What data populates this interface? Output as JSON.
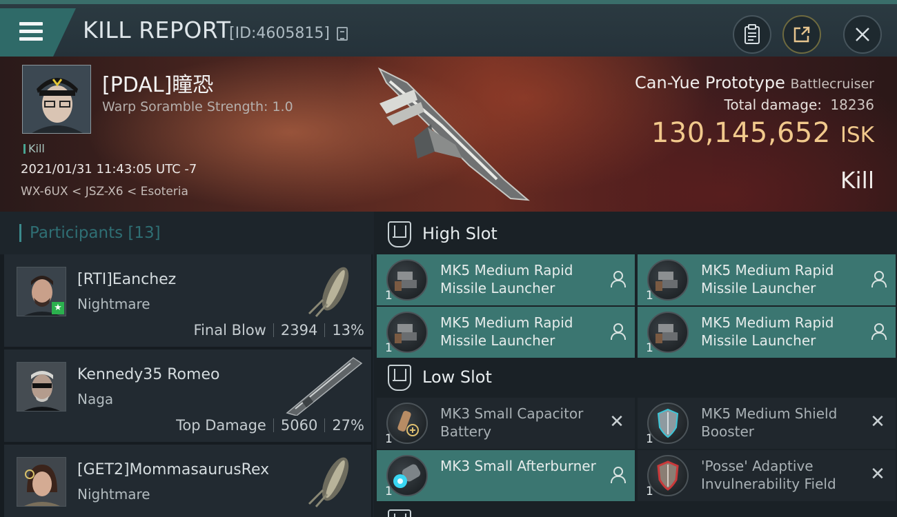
{
  "header": {
    "title": "KILL REPORT",
    "id_text": "[ID:4605815]"
  },
  "victim": {
    "name": "[PDAL]瞳恐",
    "subtitle": "Warp Soramble Strength: 1.0",
    "tag": "Kill",
    "timestamp": "2021/01/31 11:43:05 UTC -7",
    "location": "WX-6UX < JSZ-X6 < Esoteria",
    "ship_name": "Can-Yue Prototype",
    "ship_class": "Battlecruiser",
    "total_damage_label": "Total damage:",
    "total_damage": "18236",
    "isk_value": "130,145,652",
    "isk_unit": "ISK",
    "result": "Kill"
  },
  "participants": {
    "label": "Participants",
    "count": "[13]",
    "rows": [
      {
        "name": "[RTI]Eanchez",
        "ship": "Nightmare",
        "role": "Final Blow",
        "damage": "2394",
        "percent": "13%"
      },
      {
        "name": "Kennedy35 Romeo",
        "ship": "Naga",
        "role": "Top Damage",
        "damage": "5060",
        "percent": "27%"
      },
      {
        "name": "[GET2]MommasaurusRex",
        "ship": "Nightmare",
        "role": "",
        "damage": "",
        "percent": ""
      }
    ]
  },
  "slots": {
    "high": {
      "label": "High Slot",
      "modules": [
        {
          "name": "MK5 Medium Rapid Missile Launcher",
          "qty": "1",
          "state": "fitted"
        },
        {
          "name": "MK5 Medium Rapid Missile Launcher",
          "qty": "1",
          "state": "fitted"
        },
        {
          "name": "MK5 Medium Rapid Missile Launcher",
          "qty": "1",
          "state": "fitted"
        },
        {
          "name": "MK5 Medium Rapid Missile Launcher",
          "qty": "1",
          "state": "fitted"
        }
      ]
    },
    "low": {
      "label": "Low Slot",
      "modules": [
        {
          "name": "MK3 Small Capacitor Battery",
          "qty": "1",
          "state": "destroyed"
        },
        {
          "name": "MK5 Medium Shield Booster",
          "qty": "1",
          "state": "destroyed"
        },
        {
          "name": "MK3 Small Afterburner",
          "qty": "1",
          "state": "fitted"
        },
        {
          "name": "'Posse' Adaptive Invulnerability Field",
          "qty": "1",
          "state": "destroyed"
        }
      ]
    }
  },
  "colors": {
    "accent_teal": "#3b7671",
    "isk_gold": "#f1c98c",
    "header_bg": "#2b3a41"
  },
  "icons": {
    "menu": "hamburger-icon",
    "copy": "copy-icon",
    "clipboard": "clipboard-icon",
    "share": "share-icon",
    "close": "close-icon"
  }
}
